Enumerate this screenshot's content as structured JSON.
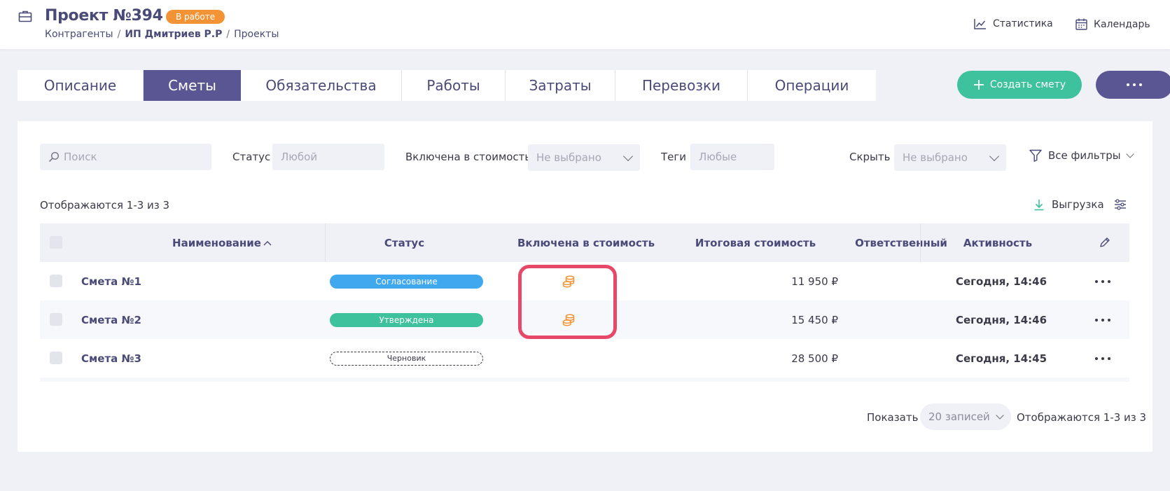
{
  "header": {
    "title": "Проект №394",
    "status": "В работе",
    "breadcrumbs": [
      "Контрагенты",
      "ИП Дмитриев Р.Р",
      "Проекты"
    ],
    "links": {
      "statistics": "Статистика",
      "calendar": "Календарь"
    }
  },
  "tabs": [
    "Описание",
    "Сметы",
    "Обязательства",
    "Работы",
    "Затраты",
    "Перевозки",
    "Операции"
  ],
  "actions": {
    "create": "Создать смету"
  },
  "filters": {
    "search_placeholder": "Поиск",
    "status_label": "Статус",
    "status_value": "Любой",
    "included_label": "Включена в стоимость",
    "included_value": "Не выбрано",
    "tags_label": "Теги",
    "tags_value": "Любые",
    "hide_label": "Скрыть",
    "hide_value": "Не выбрано",
    "all_filters": "Все фильтры"
  },
  "list": {
    "count_text": "Отображаются 1-3 из 3",
    "export": "Выгрузка"
  },
  "table": {
    "columns": [
      "Наименование",
      "Статус",
      "Включена в стоимость",
      "Итоговая стоимость",
      "Ответственный",
      "Активность"
    ],
    "rows": [
      {
        "name": "Смета №1",
        "status": "Согласование",
        "status_color": "#3fa8ef",
        "included_icon": "coins-icon",
        "total": "11 950 ₽",
        "responsible": "",
        "activity": "Сегодня, 14:46"
      },
      {
        "name": "Смета №2",
        "status": "Утверждена",
        "status_color": "#3ec29e",
        "included_icon": "coins-icon",
        "total": "15 450 ₽",
        "responsible": "",
        "activity": "Сегодня, 14:46"
      },
      {
        "name": "Смета №3",
        "status": "Черновик",
        "status_color": "dashed",
        "included_icon": "",
        "total": "28 500 ₽",
        "responsible": "",
        "activity": "Сегодня, 14:45"
      }
    ]
  },
  "pagination": {
    "show_label": "Показать",
    "page_size": "20 записей",
    "count_text": "Отображаются 1-3 из 3"
  },
  "colors": {
    "accent": "#5a5593",
    "green": "#3ec29e",
    "blue": "#3fa8ef",
    "orange": "#f29436",
    "highlight": "#e84868"
  }
}
